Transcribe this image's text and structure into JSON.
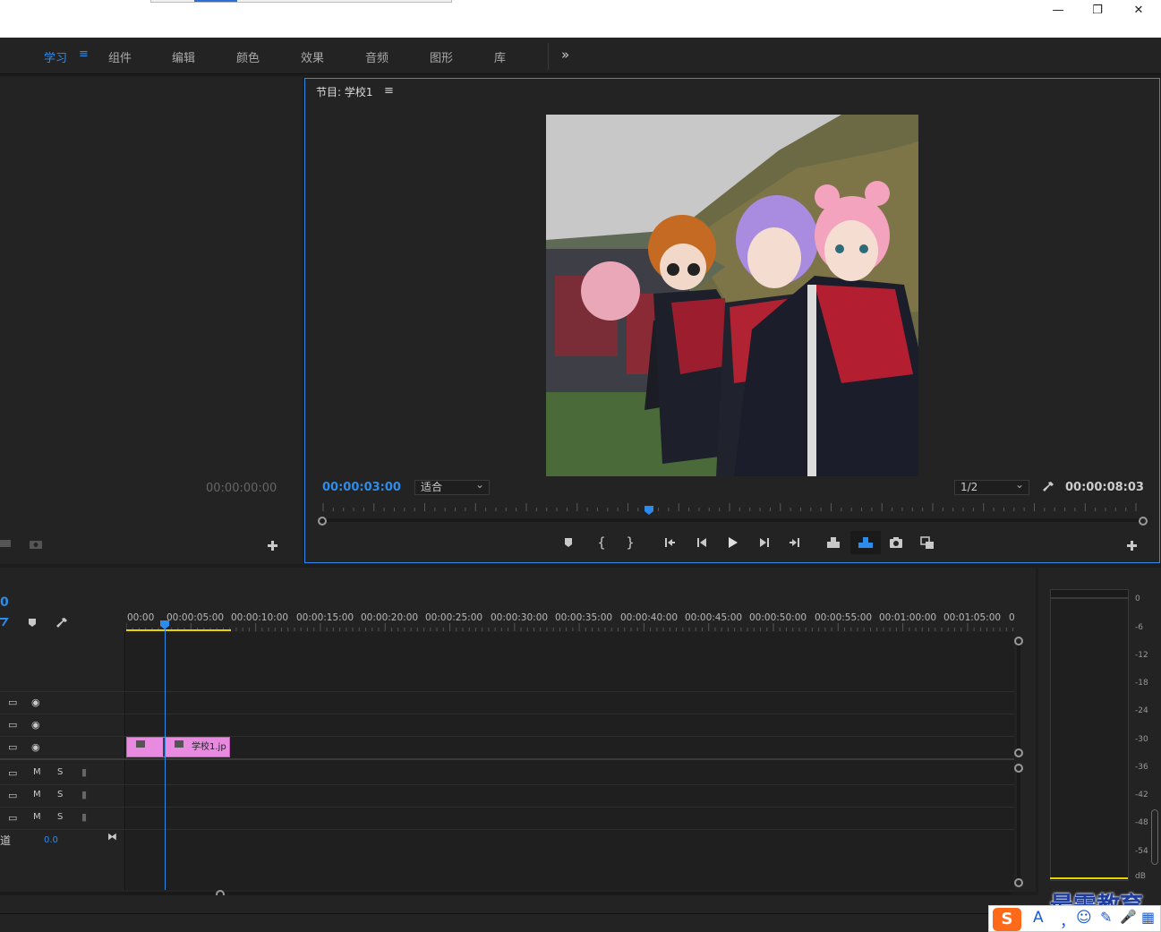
{
  "window": {
    "minimize": "—",
    "restore": "❐",
    "close": "✕"
  },
  "workspace_tabs": [
    "学习",
    "组件",
    "编辑",
    "颜色",
    "效果",
    "音频",
    "图形",
    "库"
  ],
  "workspace_menu_icon": "≡",
  "workspace_more": "»",
  "source_panel": {
    "timecode": "00:00:00:00"
  },
  "program_monitor": {
    "title": "节目: 学校1",
    "menu_icon": "≡",
    "current_timecode": "00:00:03:00",
    "zoom_select": "适合",
    "resolution_select": "1/2",
    "duration_timecode": "00:00:08:03",
    "playhead_fraction": 0.4
  },
  "timeline": {
    "timecode_fragment": "0",
    "ruler_ticks": [
      "00:00",
      "00:00:05:00",
      "00:00:10:00",
      "00:00:15:00",
      "00:00:20:00",
      "00:00:25:00",
      "00:00:30:00",
      "00:00:35:00",
      "00:00:40:00",
      "00:00:45:00",
      "00:00:50:00",
      "00:00:55:00",
      "00:01:00:00",
      "00:01:05:00",
      "0"
    ],
    "clip_label": "学校1.jp",
    "audio_m": "M",
    "audio_s": "S",
    "master_label": "道",
    "master_value": "0.0"
  },
  "audio_meter": {
    "scale": [
      "0",
      "-6",
      "-12",
      "-18",
      "-24",
      "-30",
      "-36",
      "-42",
      "-48",
      "-54",
      "dB"
    ]
  },
  "watermark": "最需教育",
  "ime": {
    "logo": "S",
    "items": [
      "A",
      "，",
      "☺",
      "✎",
      "🎤",
      "▦"
    ]
  },
  "colors": {
    "accent": "#2d8ceb",
    "clip": "#e88ae0",
    "workarea": "#e5d400"
  }
}
